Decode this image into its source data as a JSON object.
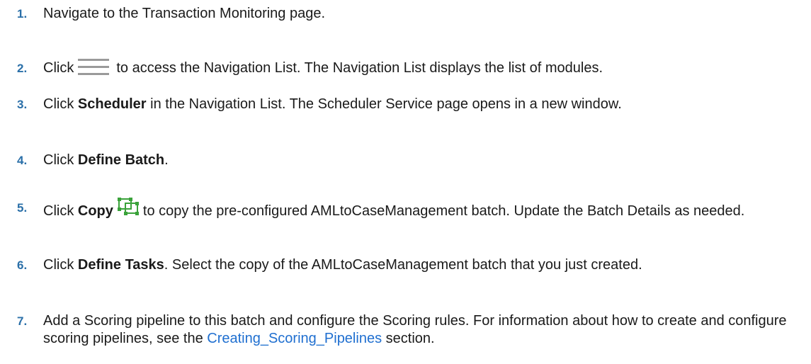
{
  "steps": [
    {
      "number": "1.",
      "text": "Navigate to the Transaction Monitoring page."
    },
    {
      "number": "2.",
      "pre": "Click",
      "icon": "hamburger-menu-icon",
      "post": "to access the Navigation List. The Navigation List displays the list of modules."
    },
    {
      "number": "3.",
      "pre": "Click ",
      "bold": "Scheduler",
      "post": " in the Navigation List. The Scheduler Service page opens in a new window."
    },
    {
      "number": "4.",
      "pre": "Click ",
      "bold": "Define Batch",
      "post": "."
    },
    {
      "number": "5.",
      "pre": "Click ",
      "bold": "Copy",
      "icon": "copy-icon",
      "post": "to copy the pre-configured AMLtoCaseManagement batch. Update the Batch Details as needed."
    },
    {
      "number": "6.",
      "pre": "Click ",
      "bold": "Define Tasks",
      "post": ". Select the copy of the AMLtoCaseManagement batch that you just created."
    },
    {
      "number": "7.",
      "pre": "Add a Scoring pipeline to this batch and configure the Scoring rules. For information about how to create and configure scoring pipelines, see the ",
      "link": "Creating_Scoring_Pipelines",
      "post": " section."
    }
  ],
  "colors": {
    "number": "#2a6fa8",
    "link": "#1f6fd0",
    "icon_gray": "#9a9a9a",
    "icon_green": "#3aa23a"
  }
}
